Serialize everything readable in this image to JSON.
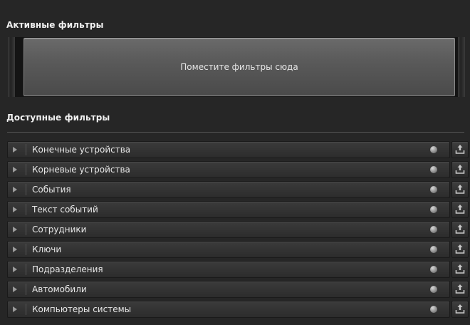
{
  "active_filters": {
    "title": "Активные фильтры",
    "dropzone_text": "Поместите фильтры сюда"
  },
  "available_filters": {
    "title": "Доступные фильтры",
    "items": [
      {
        "label": "Конечные устройства"
      },
      {
        "label": "Корневые устройства"
      },
      {
        "label": "События"
      },
      {
        "label": "Текст событий"
      },
      {
        "label": "Сотрудники"
      },
      {
        "label": "Ключи"
      },
      {
        "label": "Подразделения"
      },
      {
        "label": "Автомобили"
      },
      {
        "label": "Компьютеры системы"
      }
    ]
  },
  "icons": {
    "expand": "chevron-right-icon",
    "status": "status-dot-icon",
    "upload": "upload-icon"
  },
  "colors": {
    "background": "#262626",
    "dropzone": "#5a5a5a",
    "row": "#333333",
    "text": "#e8e8e8"
  }
}
